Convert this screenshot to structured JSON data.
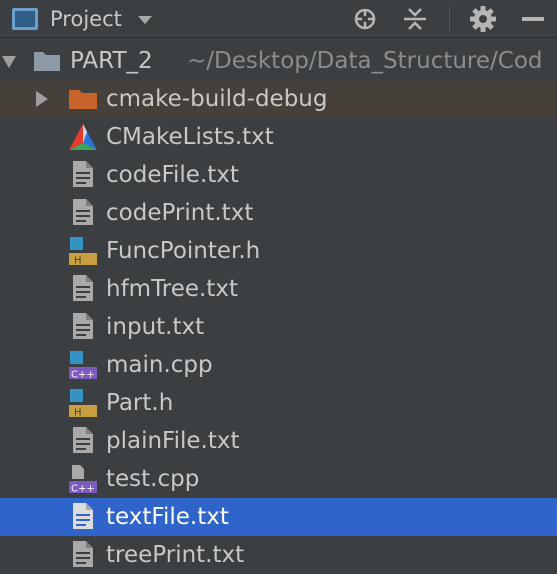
{
  "toolbar": {
    "title": "Project",
    "icons": [
      "project-view-icon",
      "dropdown-caret-icon",
      "locate-crosshair-icon",
      "collapse-all-icon",
      "gear-icon",
      "hide-minus-icon"
    ]
  },
  "tree": {
    "root": {
      "name": "PART_2",
      "path": "~/Desktop/Data_Structure/Cod",
      "expanded": true
    },
    "items": [
      {
        "name": "cmake-build-debug",
        "type": "folder",
        "icon": "orange-folder-icon",
        "expanded": false
      },
      {
        "name": "CMakeLists.txt",
        "type": "cmake",
        "icon": "cmake-triangle-icon"
      },
      {
        "name": "codeFile.txt",
        "type": "text",
        "icon": "text-file-icon"
      },
      {
        "name": "codePrint.txt",
        "type": "text",
        "icon": "text-file-icon"
      },
      {
        "name": "FuncPointer.h",
        "type": "header",
        "icon": "h-header-file-icon",
        "badge": "H"
      },
      {
        "name": "hfmTree.txt",
        "type": "text",
        "icon": "text-file-icon"
      },
      {
        "name": "input.txt",
        "type": "text",
        "icon": "text-file-icon"
      },
      {
        "name": "main.cpp",
        "type": "cpp",
        "icon": "cpp-file-icon",
        "badge": "C++"
      },
      {
        "name": "Part.h",
        "type": "header",
        "icon": "h-header-file-icon",
        "badge": "H"
      },
      {
        "name": "plainFile.txt",
        "type": "text",
        "icon": "text-file-icon"
      },
      {
        "name": "test.cpp",
        "type": "cpp",
        "icon": "cpp-file-icon",
        "badge": "C++"
      },
      {
        "name": "textFile.txt",
        "type": "text",
        "icon": "text-file-icon",
        "selected": true
      },
      {
        "name": "treePrint.txt",
        "type": "text",
        "icon": "text-file-icon"
      }
    ]
  },
  "colors": {
    "background": "#3c3f41",
    "selection": "#2f65ca",
    "folder_row": "#45413a",
    "folder_orange": "#c9632b",
    "header_badge": "#c89f41",
    "cpp_badge": "#7e59bf"
  }
}
